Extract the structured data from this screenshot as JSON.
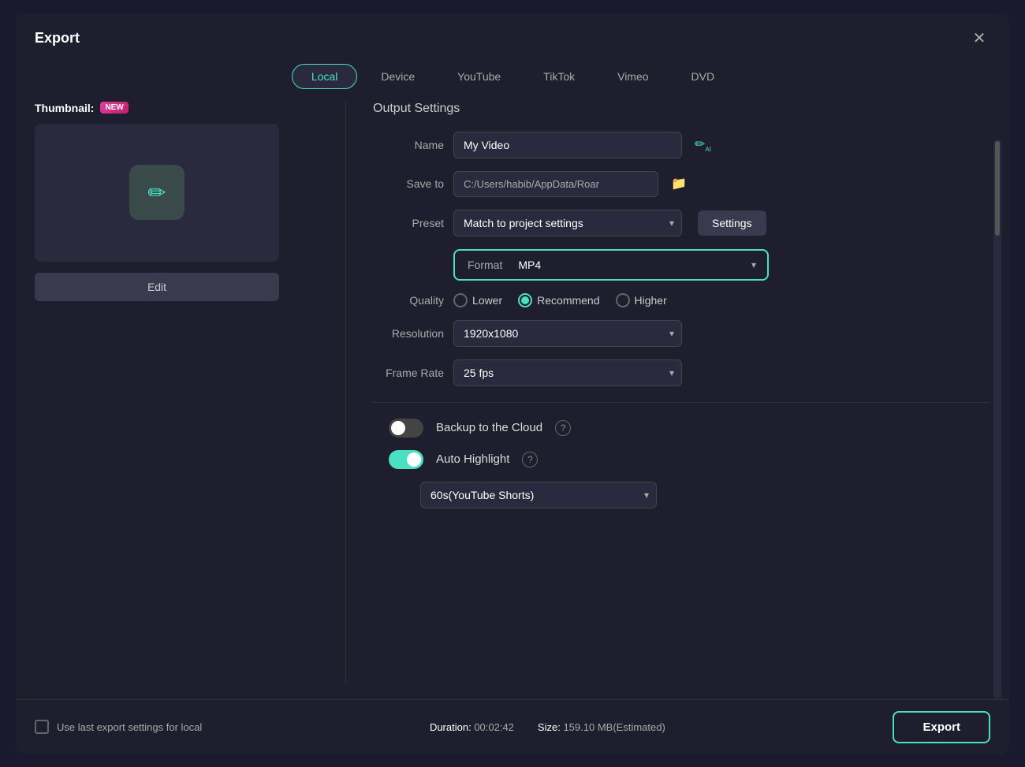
{
  "dialog": {
    "title": "Export",
    "close_label": "✕"
  },
  "tabs": [
    {
      "id": "local",
      "label": "Local",
      "active": true
    },
    {
      "id": "device",
      "label": "Device",
      "active": false
    },
    {
      "id": "youtube",
      "label": "YouTube",
      "active": false
    },
    {
      "id": "tiktok",
      "label": "TikTok",
      "active": false
    },
    {
      "id": "vimeo",
      "label": "Vimeo",
      "active": false
    },
    {
      "id": "dvd",
      "label": "DVD",
      "active": false
    }
  ],
  "left_panel": {
    "thumbnail_label": "Thumbnail:",
    "new_badge": "NEW",
    "edit_button": "Edit"
  },
  "right_panel": {
    "output_settings_title": "Output Settings",
    "name_label": "Name",
    "name_value": "My Video",
    "save_to_label": "Save to",
    "save_to_value": "C:/Users/habib/AppData/Roar",
    "preset_label": "Preset",
    "preset_value": "Match to project settings",
    "settings_button": "Settings",
    "format_label": "Format",
    "format_value": "MP4",
    "quality_label": "Quality",
    "quality_options": [
      {
        "id": "lower",
        "label": "Lower",
        "checked": false
      },
      {
        "id": "recommend",
        "label": "Recommend",
        "checked": true
      },
      {
        "id": "higher",
        "label": "Higher",
        "checked": false
      }
    ],
    "resolution_label": "Resolution",
    "resolution_value": "1920x1080",
    "frame_rate_label": "Frame Rate",
    "frame_rate_value": "25 fps",
    "backup_cloud_label": "Backup to the Cloud",
    "backup_cloud_enabled": false,
    "auto_highlight_label": "Auto Highlight",
    "auto_highlight_enabled": true,
    "auto_highlight_dropdown": "60s(YouTube Shorts)"
  },
  "bottom": {
    "use_last_label": "Use last export settings for local",
    "duration_label": "Duration:",
    "duration_value": "00:02:42",
    "size_label": "Size:",
    "size_value": "159.10 MB(Estimated)",
    "export_button": "Export"
  }
}
